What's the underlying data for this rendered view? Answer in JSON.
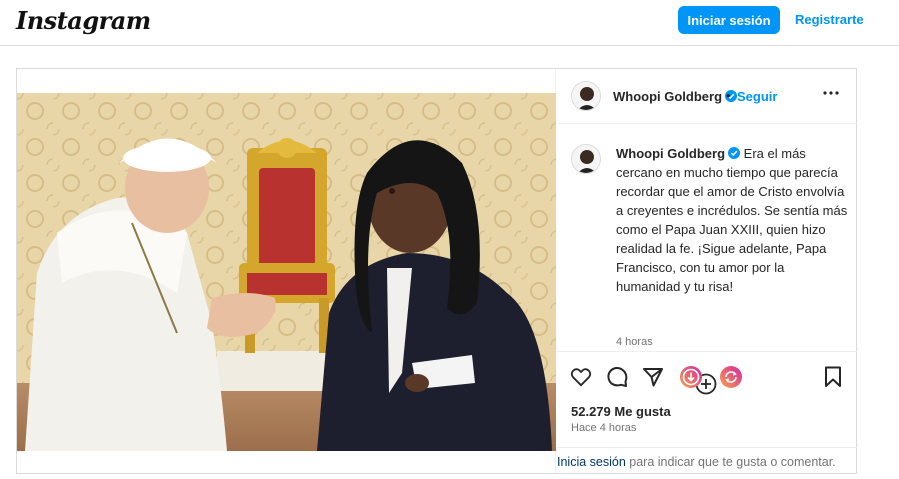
{
  "nav": {
    "logo": "Instagram",
    "login_label": "Iniciar sesión",
    "register_label": "Registrarte"
  },
  "post": {
    "username": "Whoopi Goldberg",
    "follow_label": "Seguir",
    "separator": "•",
    "caption": "Era el más cercano en mucho tiempo que parecía recordar que el amor de Cristo envolvía a creyentes e incrédulos. Se sentía más como el Papa Juan XXIII, quien hizo realidad la fe. ¡Sigue adelante, Papa Francisco, con tu amor por la humanidad y tu risa!",
    "caption_time": "4 horas",
    "likes": "52.279 Me gusta",
    "posted_ago": "Hace 4 horas",
    "footer_link": "Inicia sesión",
    "footer_text": " para indicar que te gusta o comentar."
  },
  "icons": {
    "verified": "verified-badge-icon",
    "more": "more-options-icon",
    "add_comment": "add-comment-icon",
    "like": "heart-icon",
    "comment": "comment-icon",
    "share": "share-icon",
    "gift": "gift-icon",
    "remix": "remix-icon",
    "save": "bookmark-icon"
  },
  "colors": {
    "accent": "#0095f6",
    "verified": "#0095f6",
    "gift_gradient_start": "#f7a34b",
    "gift_gradient_end": "#d6249f"
  }
}
